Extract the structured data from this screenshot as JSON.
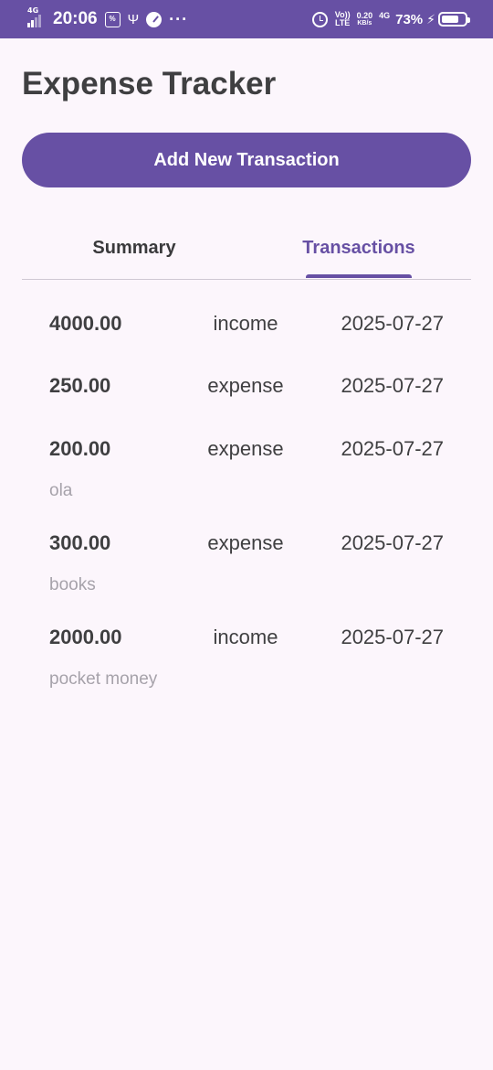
{
  "status_bar": {
    "network_tag": "4G",
    "time": "20:06",
    "volte_top": "Vo))",
    "volte_bottom": "LTE",
    "speed_value": "0.20",
    "speed_unit": "KB/s",
    "network_tag_2": "4G",
    "battery_percent": "73%",
    "battery_level": 0.73,
    "icons": [
      "signal-icon",
      "box-icon",
      "usb-icon",
      "gauge-icon",
      "more-dots-icon",
      "alarm-icon",
      "bolt-icon",
      "battery-icon"
    ]
  },
  "app": {
    "title": "Expense Tracker",
    "add_button_label": "Add New Transaction",
    "tabs": [
      {
        "label": "Summary",
        "active": false
      },
      {
        "label": "Transactions",
        "active": true
      }
    ],
    "accent_color": "#6750a4"
  },
  "transactions": [
    {
      "amount": "4000.00",
      "type": "income",
      "date": "2025-07-27",
      "note": ""
    },
    {
      "amount": "250.00",
      "type": "expense",
      "date": "2025-07-27",
      "note": ""
    },
    {
      "amount": "200.00",
      "type": "expense",
      "date": "2025-07-27",
      "note": "ola"
    },
    {
      "amount": "300.00",
      "type": "expense",
      "date": "2025-07-27",
      "note": "books"
    },
    {
      "amount": "2000.00",
      "type": "income",
      "date": "2025-07-27",
      "note": "pocket money"
    }
  ]
}
